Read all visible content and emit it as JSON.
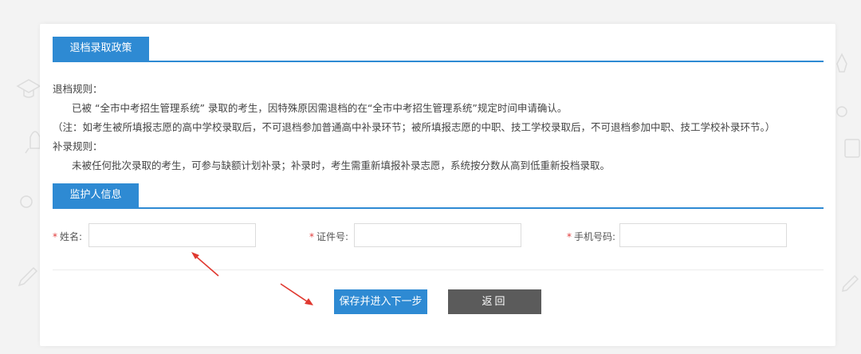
{
  "section_policy": {
    "title": "退档录取政策"
  },
  "rules": {
    "withdraw_heading": "退档规则：",
    "withdraw_text": "已被 “全市中考招生管理系统” 录取的考生，因特殊原因需退档的在“全市中考招生管理系统”规定时间申请确认。",
    "withdraw_note": "（注：如考生被所填报志愿的高中学校录取后，不可退档参加普通高中补录环节；被所填报志愿的中职、技工学校录取后，不可退档参加中职、技工学校补录环节。）",
    "supplement_heading": "补录规则：",
    "supplement_text": "未被任何批次录取的考生，可参与缺额计划补录；补录时，考生需重新填报补录志愿，系统按分数从高到低重新投档录取。"
  },
  "section_guardian": {
    "title": "监护人信息"
  },
  "form": {
    "required_mark": "*",
    "name_label": "姓名:",
    "name_value": "",
    "id_label": "证件号:",
    "id_value": "",
    "phone_label": "手机号码:",
    "phone_value": ""
  },
  "buttons": {
    "save_next": "保存并进入下一步",
    "back": "返回"
  },
  "colors": {
    "accent": "#2e8ad3",
    "required": "#e03b3b",
    "back_button": "#5b5b5b",
    "annotation_arrow": "#e0382f"
  }
}
